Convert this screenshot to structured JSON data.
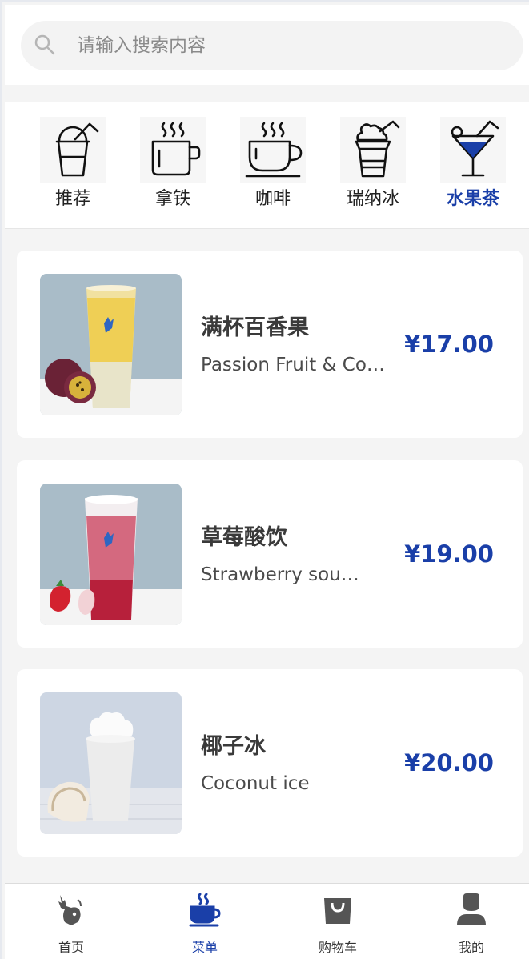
{
  "search": {
    "placeholder": "请输入搜索内容"
  },
  "categories": [
    {
      "label": "推荐",
      "icon": "cup-with-straw-icon"
    },
    {
      "label": "拿铁",
      "icon": "steaming-mug-icon"
    },
    {
      "label": "咖啡",
      "icon": "coffee-cup-icon"
    },
    {
      "label": "瑞纳冰",
      "icon": "frappe-icon"
    },
    {
      "label": "水果茶",
      "icon": "cocktail-icon",
      "active": true
    }
  ],
  "products": [
    {
      "name": "满杯百香果",
      "en": "Passion Fruit & Co…",
      "price": "¥17.00"
    },
    {
      "name": "草莓酸饮",
      "en": "Strawberry sou…",
      "price": "¥19.00"
    },
    {
      "name": "椰子冰",
      "en": "Coconut ice",
      "price": "¥20.00"
    }
  ],
  "tabs": [
    {
      "label": "首页",
      "icon": "deer-logo-icon"
    },
    {
      "label": "菜单",
      "icon": "coffee-cup-icon",
      "active": true
    },
    {
      "label": "购物车",
      "icon": "shopping-bag-icon"
    },
    {
      "label": "我的",
      "icon": "user-icon"
    }
  ],
  "colors": {
    "accent": "#1a3fa8",
    "text": "#3a3a3a",
    "background": "#f4f4f4"
  }
}
